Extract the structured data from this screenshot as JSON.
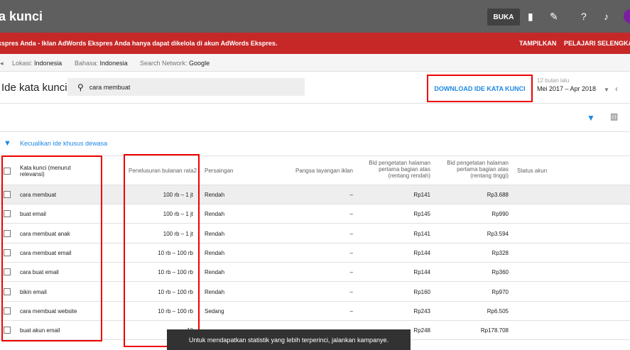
{
  "topbar": {
    "title": "a kunci",
    "buka_label": "BUKA"
  },
  "banner": {
    "message": "kspres Anda - Iklan AdWords Ekspres Anda hanya dapat dikelola di akun AdWords Ekspres.",
    "show_label": "TAMPILKAN",
    "learn_label": "PELAJARI SELENGKAPN"
  },
  "filters": {
    "location_label": "Lokasi:",
    "location_value": "Indonesia",
    "language_label": "Bahasa:",
    "language_value": "Indonesia",
    "network_label": "Search Network:",
    "network_value": "Google"
  },
  "search": {
    "heading": "Ide kata kunci",
    "query": "cara membuat",
    "download_label": "DOWNLOAD IDE KATA KUNCI",
    "range_label": "12 bulan lalu",
    "range_value": "Mei 2017 – Apr 2018"
  },
  "exclude_adult": "Kecualikan ide khusus dewasa",
  "table": {
    "headers": {
      "keyword": "Kata kunci (menurut relevansi)",
      "searches": "Penelusuran bulanan rata2",
      "competition": "Persaingan",
      "impression_share": "Pangsa tayangan iklan",
      "bid_low": "Bid pengetatan halaman pertama bagian atas (rentang rendah)",
      "bid_high": "Bid pengetatan halaman pertama bagian atas (rentang tinggi)",
      "status": "Status akun"
    },
    "rows": [
      {
        "keyword": "cara membuat",
        "searches": "100 rb – 1 jt",
        "competition": "Rendah",
        "share": "–",
        "low": "Rp141",
        "high": "Rp3.688"
      },
      {
        "keyword": "buat email",
        "searches": "100 rb – 1 jt",
        "competition": "Rendah",
        "share": "–",
        "low": "Rp145",
        "high": "Rp990"
      },
      {
        "keyword": "cara membuat anak",
        "searches": "100 rb – 1 jt",
        "competition": "Rendah",
        "share": "–",
        "low": "Rp141",
        "high": "Rp3.594"
      },
      {
        "keyword": "cara membuat email",
        "searches": "10 rb – 100 rb",
        "competition": "Rendah",
        "share": "–",
        "low": "Rp144",
        "high": "Rp328"
      },
      {
        "keyword": "cara buat email",
        "searches": "10 rb – 100 rb",
        "competition": "Rendah",
        "share": "–",
        "low": "Rp144",
        "high": "Rp360"
      },
      {
        "keyword": "bikin email",
        "searches": "10 rb – 100 rb",
        "competition": "Rendah",
        "share": "–",
        "low": "Rp160",
        "high": "Rp970"
      },
      {
        "keyword": "cara membuat website",
        "searches": "10 rb – 100 rb",
        "competition": "Sedang",
        "share": "–",
        "low": "Rp243",
        "high": "Rp6.505"
      },
      {
        "keyword": "buat akun email",
        "searches": "10",
        "competition": "",
        "share": "–",
        "low": "Rp248",
        "high": "Rp178.708"
      }
    ]
  },
  "toast": "Untuk mendapatkan statistik yang lebih terperinci, jalankan kampanye."
}
